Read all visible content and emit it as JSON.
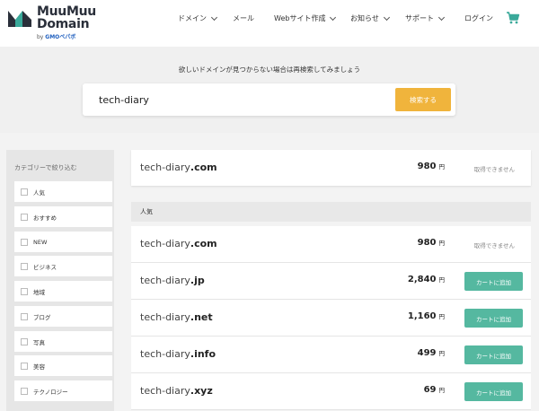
{
  "header": {
    "logo_line1": "MuuMuu",
    "logo_line2": "Domain",
    "logo_sub_prefix": "by",
    "logo_sub_brand": "GMOペパボ",
    "nav": [
      {
        "label": "ドメイン",
        "has_dropdown": true
      },
      {
        "label": "メール",
        "has_dropdown": false
      },
      {
        "label": "Webサイト作成",
        "has_dropdown": true
      },
      {
        "label": "お知らせ",
        "has_dropdown": true
      },
      {
        "label": "サポート",
        "has_dropdown": true
      },
      {
        "label": "ログイン",
        "has_dropdown": false
      }
    ],
    "cart_icon": "shopping-cart-icon"
  },
  "search": {
    "hint": "欲しいドメインが見つからない場合は再検索してみましょう",
    "value": "tech-diary",
    "button_label": "検索する"
  },
  "sidebar": {
    "title": "カテゴリーで絞り込む",
    "categories": [
      "人気",
      "おすすめ",
      "NEW",
      "ビジネス",
      "地域",
      "ブログ",
      "写真",
      "美容",
      "テクノロジー"
    ]
  },
  "results": {
    "top": {
      "name": "tech-diary",
      "tld": ".com",
      "price": "980",
      "currency": "円",
      "status": "取得できません"
    },
    "section_title": "人気",
    "rows": [
      {
        "name": "tech-diary",
        "tld": ".com",
        "price": "980",
        "currency": "円",
        "status": "取得できません",
        "available": false
      },
      {
        "name": "tech-diary",
        "tld": ".jp",
        "price": "2,840",
        "currency": "円",
        "action": "カートに追加",
        "available": true
      },
      {
        "name": "tech-diary",
        "tld": ".net",
        "price": "1,160",
        "currency": "円",
        "action": "カートに追加",
        "available": true
      },
      {
        "name": "tech-diary",
        "tld": ".info",
        "price": "499",
        "currency": "円",
        "action": "カートに追加",
        "available": true
      },
      {
        "name": "tech-diary",
        "tld": ".xyz",
        "price": "69",
        "currency": "円",
        "action": "カートに追加",
        "available": true
      }
    ]
  },
  "colors": {
    "accent_button": "#f0b43c",
    "add_button": "#55b8a0",
    "logo_dark": "#2a2f3a",
    "logo_teal": "#3aa99a"
  }
}
